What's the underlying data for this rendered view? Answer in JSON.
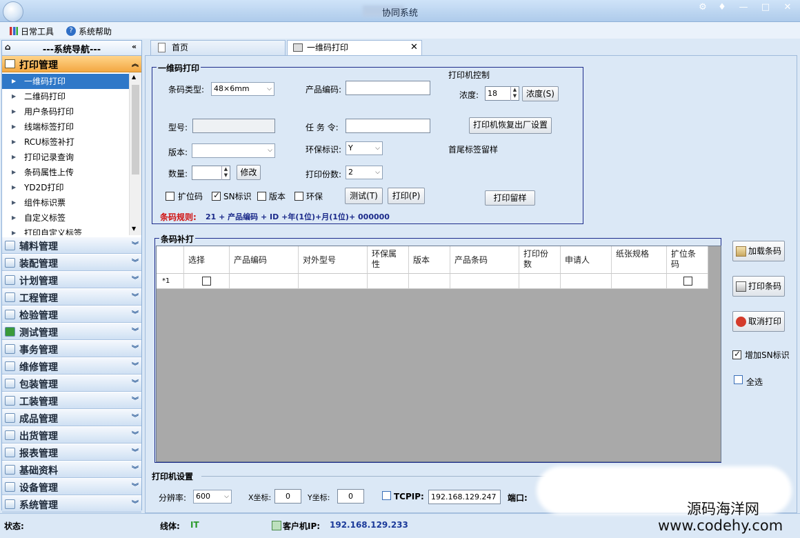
{
  "window": {
    "title": "协同系统"
  },
  "menubar": {
    "items": [
      {
        "label": "日常工具"
      },
      {
        "label": "系统帮助"
      }
    ]
  },
  "nav": {
    "header": "---系统导航---",
    "active_group": "打印管理",
    "sub_items": [
      {
        "label": "一维码打印"
      },
      {
        "label": "二维码打印"
      },
      {
        "label": "用户条码打印"
      },
      {
        "label": "线端标签打印"
      },
      {
        "label": "RCU标签补打"
      },
      {
        "label": "打印记录查询"
      },
      {
        "label": "条码属性上传"
      },
      {
        "label": "YD2D打印"
      },
      {
        "label": "组件标识票"
      },
      {
        "label": "自定义标签"
      },
      {
        "label": "打印自定义标签"
      }
    ],
    "groups": [
      {
        "label": "辅料管理"
      },
      {
        "label": "装配管理"
      },
      {
        "label": "计划管理"
      },
      {
        "label": "工程管理"
      },
      {
        "label": "检验管理"
      },
      {
        "label": "测试管理"
      },
      {
        "label": "事务管理"
      },
      {
        "label": "维修管理"
      },
      {
        "label": "包装管理"
      },
      {
        "label": "工装管理"
      },
      {
        "label": "成品管理"
      },
      {
        "label": "出货管理"
      },
      {
        "label": "报表管理"
      },
      {
        "label": "基础资料"
      },
      {
        "label": "设备管理"
      },
      {
        "label": "系统管理"
      }
    ]
  },
  "tabs": [
    {
      "label": "首页"
    },
    {
      "label": "一维码打印"
    }
  ],
  "barcode_print": {
    "title": "一维码打印",
    "barcode_type_label": "条码类型:",
    "barcode_type_value": "48×6mm",
    "product_code_label": "产品编码:",
    "model_label": "型号:",
    "task_label": "任 务 令:",
    "version_label": "版本:",
    "eco_label": "环保标识:",
    "eco_value": "Y",
    "qty_label": "数量:",
    "modify_btn": "修改",
    "copies_label": "打印份数:",
    "copies_value": "2",
    "chk_ext": "扩位码",
    "chk_sn": "SN标识",
    "chk_ver": "版本",
    "chk_eco": "环保",
    "test_btn": "测试(T)",
    "print_btn": "打印(P)",
    "rule_label": "条码规则:",
    "rule_text": "21 + 产品编码 + ID  +年(1位)+月(1位)+ 000000",
    "printer_ctrl_label": "打印机控制",
    "density_label": "浓度:",
    "density_value": "18",
    "density_btn": "浓度(S)",
    "restore_btn": "打印机恢复出厂设置",
    "sample_label": "首尾标签留样",
    "sample_btn": "打印留样"
  },
  "reprint": {
    "title": "条码补打",
    "columns": [
      "选择",
      "产品编码",
      "对外型号",
      "环保属性",
      "版本",
      "产品条码",
      "打印份数",
      "申请人",
      "纸张规格",
      "扩位条码"
    ],
    "row_marker": "*1"
  },
  "side_buttons": {
    "load": "加载条码",
    "print": "打印条码",
    "cancel": "取消打印",
    "add_sn": "增加SN标识",
    "select_all": "全选"
  },
  "printer_settings": {
    "title": "打印机设置",
    "resolution_label": "分辨率:",
    "resolution_value": "600",
    "x_label": "X坐标:",
    "x_value": "0",
    "y_label": "Y坐标:",
    "y_value": "0",
    "tcpip_label": "TCPIP:",
    "ip_value": "192.168.129.247",
    "port_label": "端口:"
  },
  "status": {
    "state_label": "状态:",
    "line_label": "线体:",
    "line_value": "IT",
    "client_ip_label": "客户机IP:",
    "client_ip_value": "192.168.129.233"
  },
  "watermark": {
    "line1": "源码海洋网",
    "line2": "www.codehy.com"
  }
}
